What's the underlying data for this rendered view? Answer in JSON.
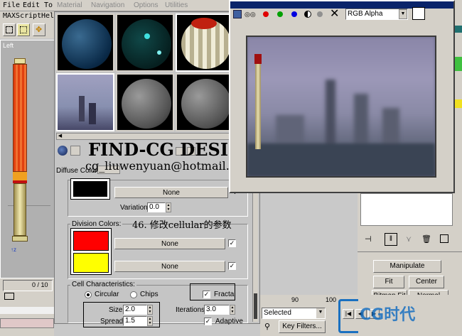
{
  "menubar": {
    "items": [
      "File",
      "Edit",
      "To",
      "Material",
      "Navigation",
      "Options",
      "Utilities"
    ],
    "items_row2": [
      "MAXScript",
      "Hel"
    ]
  },
  "viewport": {
    "label": "Left"
  },
  "timeline": {
    "frame_counter": "0 / 10"
  },
  "material_editor": {
    "diffuse_color_label": "Diffuse Color",
    "diffuse_color_hex": "#000000",
    "diffuse_map_button": "None",
    "variation_label": "Variation:",
    "variation_value": "0.0",
    "division_colors": {
      "label": "Division Colors:",
      "color1_hex": "#ff0000",
      "color2_hex": "#ffff00",
      "map1_button": "None",
      "map2_button": "None"
    },
    "cell_characteristics": {
      "label": "Cell Characteristics:",
      "circular_label": "Circular",
      "chips_label": "Chips",
      "selected": "Circular",
      "fractal_label": "Fractal",
      "fractal_checked": true,
      "size_label": "Size:",
      "size_value": "2.0",
      "spread_label": "Spread:",
      "spread_value": "1.5",
      "iterations_label": "Iterations:",
      "iterations_value": "3.0",
      "adaptive_label": "Adaptive",
      "adaptive_checked": true
    }
  },
  "render_window": {
    "channel_select": "RGB Alpha",
    "channel_colors": [
      "#e00000",
      "#00a000",
      "#0000e0"
    ]
  },
  "right_panel": {
    "manipulate": "Manipulate",
    "fit": "Fit",
    "center": "Center",
    "bitmap_fit": "Bitmap Fit",
    "normal_align": "Normal Align"
  },
  "bottom": {
    "selected_dropdown": "Selected",
    "key_filters": "Key Filters...",
    "ruler_90": "90",
    "ruler_100": "100"
  },
  "watermark": {
    "title": "FIND-CG DESIGN",
    "email": "cg_liuwenyuan@hotmail.com",
    "caption": "46. 修改cellular的参数",
    "logo_text": "CG时代"
  }
}
